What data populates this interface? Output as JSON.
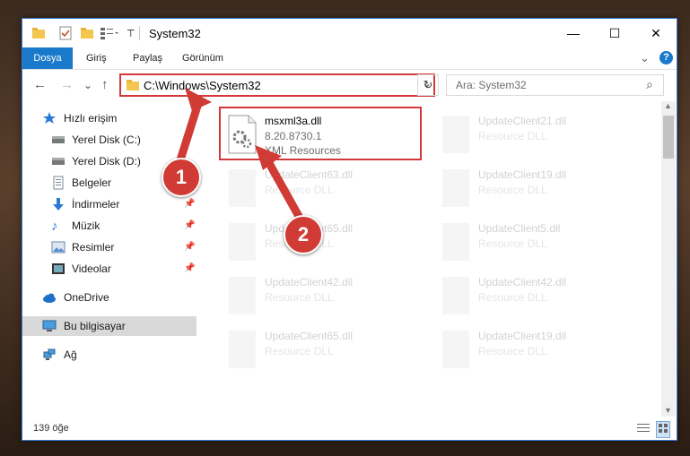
{
  "window": {
    "title": "System32",
    "minimize": "—",
    "maximize": "☐",
    "close": "✕"
  },
  "ribbon": {
    "tabs": [
      "Dosya",
      "Giriş",
      "Paylaş",
      "Görünüm"
    ],
    "expand": "⌄",
    "help": "?"
  },
  "navigation": {
    "back": "←",
    "forward": "→",
    "recent": "⌄",
    "up": "↑"
  },
  "address": {
    "path": "C:\\Windows\\System32",
    "dropdown": "⌄",
    "refresh": "↻"
  },
  "search": {
    "placeholder": "Ara: System32",
    "icon": "⌕"
  },
  "sidebar": {
    "quick_access": "Hızlı erişim",
    "items": [
      {
        "label": "Yerel Disk (C:)",
        "icon": "drive-icon",
        "pinned": false
      },
      {
        "label": "Yerel Disk (D:)",
        "icon": "drive-icon",
        "pinned": false
      },
      {
        "label": "Belgeler",
        "icon": "documents-icon",
        "pinned": false
      },
      {
        "label": "İndirmeler",
        "icon": "download-icon",
        "pinned": true
      },
      {
        "label": "Müzik",
        "icon": "music-icon",
        "pinned": true
      },
      {
        "label": "Resimler",
        "icon": "pictures-icon",
        "pinned": true
      },
      {
        "label": "Videolar",
        "icon": "videos-icon",
        "pinned": true
      }
    ],
    "onedrive": "OneDrive",
    "this_pc": "Bu bilgisayar",
    "network": "Ağ"
  },
  "files": {
    "main": {
      "name": "msxml3a.dll",
      "version": "8.20.8730.1",
      "type": "XML Resources"
    },
    "faded": [
      {
        "name": "UpdateClient21.dll",
        "type": "Resource DLL"
      },
      {
        "name": "UpdateClient63.dll",
        "type": "Resource DLL"
      },
      {
        "name": "UpdateClient19.dll",
        "type": "Resource DLL"
      },
      {
        "name": "UpdateClient65.dll",
        "type": "Resource DLL"
      },
      {
        "name": "UpdateClient5.dll",
        "type": "Resource DLL"
      },
      {
        "name": "UpdateClient42.dll",
        "type": "Resource DLL"
      },
      {
        "name": "UpdateClient42.dll",
        "type": "Resource DLL"
      },
      {
        "name": "UpdateClient65.dll",
        "type": "Resource DLL"
      },
      {
        "name": "UpdateClient19.dll",
        "type": "Resource DLL"
      }
    ]
  },
  "status": {
    "count": "139 öğe"
  },
  "annotations": [
    "1",
    "2"
  ],
  "colors": {
    "accent": "#1979ca",
    "highlight": "#d3393b"
  }
}
